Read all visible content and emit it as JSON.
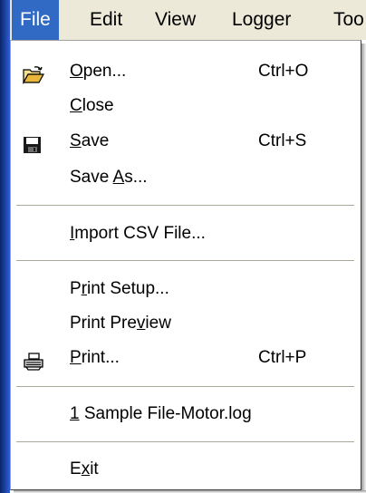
{
  "menubar": {
    "items": [
      {
        "label": "File",
        "active": true
      },
      {
        "label": "Edit"
      },
      {
        "label": "View"
      },
      {
        "label": "Logger"
      },
      {
        "label": "Too"
      }
    ]
  },
  "file_menu": {
    "items": [
      {
        "pre": "",
        "mnemonic": "O",
        "post": "pen...",
        "shortcut": "Ctrl+O",
        "icon": "open-folder-icon"
      },
      {
        "pre": "",
        "mnemonic": "C",
        "post": "lose",
        "shortcut": ""
      },
      {
        "pre": "",
        "mnemonic": "S",
        "post": "ave",
        "shortcut": "Ctrl+S",
        "icon": "floppy-disk-icon"
      },
      {
        "pre": "Save ",
        "mnemonic": "A",
        "post": "s...",
        "shortcut": ""
      },
      {
        "pre": "",
        "mnemonic": "I",
        "post": "mport CSV File...",
        "shortcut": ""
      },
      {
        "pre": "P",
        "mnemonic": "r",
        "post": "int Setup...",
        "shortcut": ""
      },
      {
        "pre": "Print Pre",
        "mnemonic": "v",
        "post": "iew",
        "shortcut": ""
      },
      {
        "pre": "",
        "mnemonic": "P",
        "post": "rint...",
        "shortcut": "Ctrl+P",
        "icon": "printer-icon"
      },
      {
        "pre": "",
        "mnemonic": "1",
        "post": " Sample File-Motor.log",
        "shortcut": ""
      },
      {
        "pre": "E",
        "mnemonic": "x",
        "post": "it",
        "shortcut": ""
      }
    ]
  },
  "colors": {
    "menu_highlight": "#316ac5",
    "menubar_bg": "#ece9d8",
    "separator": "#aca899"
  }
}
